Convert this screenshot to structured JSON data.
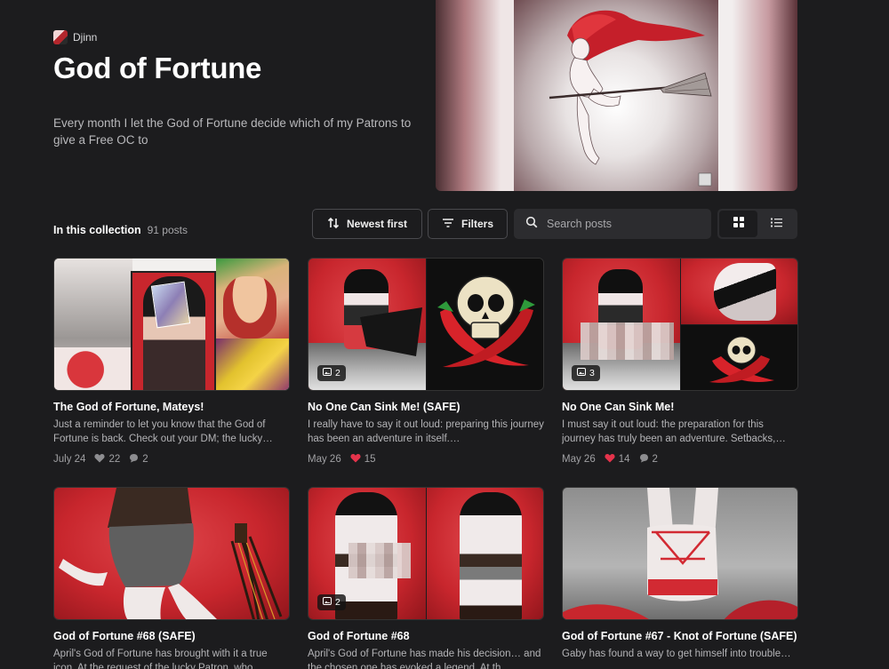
{
  "creator": {
    "name": "Djinn"
  },
  "collection": {
    "title": "God of Fortune",
    "description": "Every month I let the God of Fortune decide which of my Patrons to give a Free OC to",
    "label": "In this collection",
    "count": "91 posts"
  },
  "toolbar": {
    "sort_label": "Newest first",
    "filter_label": "Filters",
    "search_placeholder": "Search posts"
  },
  "posts": [
    {
      "title": "The God of Fortune, Mateys!",
      "excerpt": "Just a reminder to let you know that the God of Fortune is back. Check out your DM; the lucky…",
      "date": "July 24",
      "likes": "22",
      "comments": "2",
      "liked": false
    },
    {
      "title": "No One Can Sink Me! (SAFE)",
      "excerpt": "I really have to say it out loud: preparing this journey has been an adventure in itself.…",
      "date": "May 26",
      "likes": "15",
      "comments": "",
      "liked": true,
      "image_count": "2"
    },
    {
      "title": "No One Can Sink Me!",
      "excerpt": "I must say it out loud: the preparation for this journey has truly been an adventure. Setbacks,…",
      "date": "May 26",
      "likes": "14",
      "comments": "2",
      "liked": true,
      "image_count": "3"
    },
    {
      "title": "God of Fortune #68 (SAFE)",
      "excerpt": "April's God of Fortune has brought with it a true icon. At the request of the lucky Patron, who…",
      "date": "",
      "likes": "",
      "comments": ""
    },
    {
      "title": "God of Fortune #68",
      "excerpt": "April's God of Fortune has made his decision… and the chosen one has evoked a legend. At th…",
      "date": "",
      "likes": "",
      "comments": "",
      "image_count": "2"
    },
    {
      "title": "God of Fortune #67 - Knot of Fortune (SAFE)",
      "excerpt": "Gaby has found a way to get himself into trouble…",
      "date": "",
      "likes": "",
      "comments": ""
    }
  ],
  "colors": {
    "background": "#1c1c1e",
    "like": "#e5334b",
    "accent_red": "#c8262d"
  }
}
